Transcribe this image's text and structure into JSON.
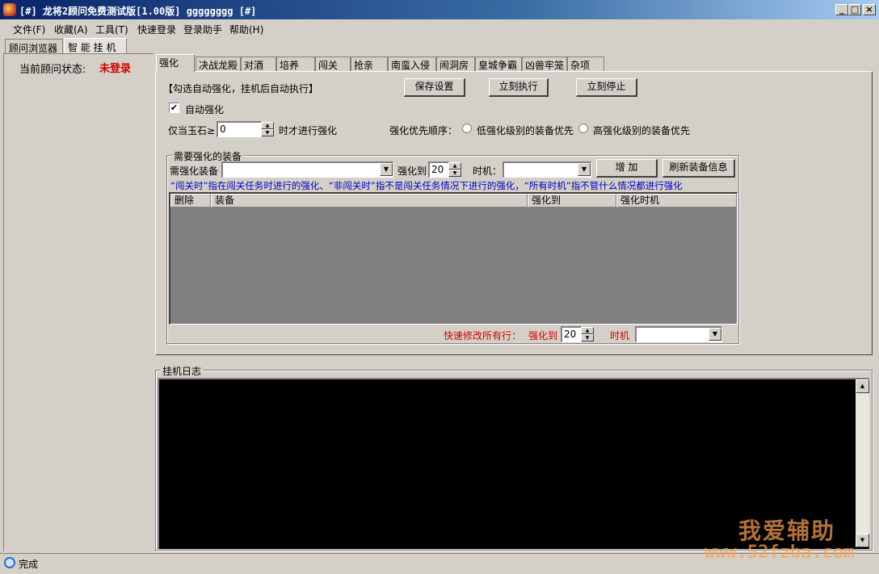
{
  "window": {
    "title": "[#] 龙将2顾问免费测试版[1.00版] gggggggg [#]",
    "controls": {
      "minimize": "_",
      "maximize": "□",
      "close": "×"
    }
  },
  "menu": [
    "文件(F)",
    "收藏(A)",
    "工具(T)",
    "快速登录",
    "登录助手",
    "帮助(H)"
  ],
  "outer_tabs": [
    "顾问浏览器",
    "智 能 挂 机"
  ],
  "left_panel": {
    "status_label": "当前顾问状态:",
    "status_value": "未登录"
  },
  "inner_tabs": [
    "强化",
    "决战龙殿",
    "对酒",
    "培养",
    "闯关",
    "抢亲",
    "南蛮入侵",
    "闹洞房",
    "皇城争霸",
    "凶兽牢笼",
    "杂项"
  ],
  "strengthen": {
    "hint": "【勾选自动强化，挂机后自动执行】",
    "save_button": "保存设置",
    "execute_button": "立刻执行",
    "stop_button": "立刻停止",
    "auto_label": "自动强化",
    "auto_checked": "✔",
    "jade_prefix": "仅当玉石≥",
    "jade_value": "0",
    "jade_suffix": "时才进行强化",
    "priority_label": "强化优先顺序：",
    "priority_low": "低强化级别的装备优先",
    "priority_high": "高强化级别的装备优先",
    "group_title": "需要强化的装备",
    "equip_label": "需强化装备",
    "to_label": "强化到",
    "to_value": "20",
    "timing_label": "时机：",
    "add_button": "增 加",
    "refresh_button": "刷新装备信息",
    "note": "“闯关时”指在闯关任务时进行的强化、“非闯关时”指不是闯关任务情况下进行的强化，“所有时机”指不管什么情况都进行强化",
    "note_color": "#0000c0",
    "table_headers": [
      "删除",
      "装备",
      "强化到",
      "强化时机"
    ],
    "quick_label": "快速修改所有行：",
    "quick_to_label": "强化到",
    "quick_to_value": "20",
    "quick_timing_label": "时机",
    "quick_color": "#d00000"
  },
  "log": {
    "title": "挂机日志"
  },
  "statusbar": {
    "text": "完成",
    "icon": "ie-icon"
  },
  "watermark": {
    "text": "我爱辅助",
    "url": "www.52fzba.com"
  }
}
